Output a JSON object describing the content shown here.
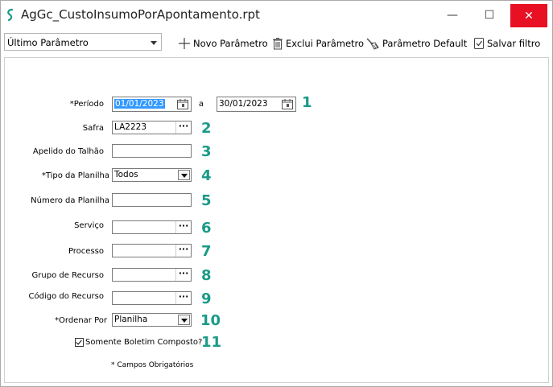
{
  "window": {
    "title": "AgGc_CustoInsumoPorApontamento.rpt",
    "minimize": "—",
    "maximize": "☐",
    "close": "✕"
  },
  "toolbar": {
    "param_select": "Último Parâmetro",
    "novo": "Novo Parâmetro",
    "exclui": "Exclui Parâmetro",
    "default": "Parâmetro Default",
    "salvar": "Salvar filtro"
  },
  "form": {
    "periodo": {
      "label": "*Período",
      "from": "01/01/2023",
      "sep": "a",
      "to": "30/01/2023",
      "num": "1"
    },
    "safra": {
      "label": "Safra",
      "value": "LA2223",
      "num": "2",
      "btn": "···"
    },
    "apelido": {
      "label": "Apelido do Talhão",
      "value": "",
      "num": "3"
    },
    "tipo": {
      "label": "*Tipo da Planilha",
      "value": "Todos",
      "num": "4"
    },
    "numero": {
      "label": "Número da Planilha",
      "value": "",
      "num": "5"
    },
    "servico": {
      "label": "Serviço",
      "value": "",
      "num": "6",
      "btn": "···"
    },
    "processo": {
      "label": "Processo",
      "value": "",
      "num": "7",
      "btn": "···"
    },
    "grupo": {
      "label": "Grupo de Recurso",
      "value": "",
      "num": "8",
      "btn": "···"
    },
    "codigo": {
      "label": "Código do Recurso",
      "value": "",
      "num": "9",
      "btn": "···"
    },
    "ordenar": {
      "label": "*Ordenar Por",
      "value": "Planilha",
      "num": "10"
    },
    "boletim": {
      "label": "Somente Boletim Composto?",
      "checked": true,
      "num": "11"
    },
    "footnote": "* Campos Obrigatórios"
  },
  "colors": {
    "accent_number": "#1a9a88",
    "close_red": "#e81123",
    "selection": "#3399ff"
  }
}
